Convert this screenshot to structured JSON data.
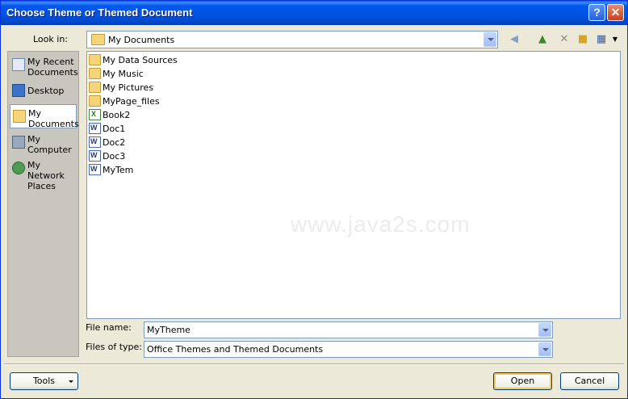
{
  "window": {
    "title": "Choose Theme or Themed Document",
    "help_label": "?",
    "close_label": "✕"
  },
  "lookin": {
    "label": "Look in:",
    "value": "My Documents"
  },
  "places": [
    {
      "label": "My Recent\nDocuments",
      "icon": "recent-documents-icon"
    },
    {
      "label": "Desktop",
      "icon": "desktop-icon"
    },
    {
      "label": "My\nDocuments",
      "icon": "my-documents-icon",
      "selected": true
    },
    {
      "label": "My\nComputer",
      "icon": "computer-icon"
    },
    {
      "label": "My Network\nPlaces",
      "icon": "network-places-icon"
    }
  ],
  "files": [
    {
      "name": "My Data Sources",
      "type": "folder"
    },
    {
      "name": "My Music",
      "type": "folder"
    },
    {
      "name": "My Pictures",
      "type": "folder"
    },
    {
      "name": "MyPage_files",
      "type": "folder"
    },
    {
      "name": "Book2",
      "type": "xls"
    },
    {
      "name": "Doc1",
      "type": "doc"
    },
    {
      "name": "Doc2",
      "type": "doc"
    },
    {
      "name": "Doc3",
      "type": "doc"
    },
    {
      "name": "MyTem",
      "type": "doc"
    }
  ],
  "watermark": "www.java2s.com",
  "filename": {
    "label": "File name:",
    "value": "MyTheme"
  },
  "filetype": {
    "label": "Files of type:",
    "value": "Office Themes and Themed Documents"
  },
  "buttons": {
    "tools": "Tools",
    "open": "Open",
    "cancel": "Cancel"
  },
  "colors": {
    "titlebar": "#0054e3",
    "dialog_bg": "#ece9d8",
    "places_bg": "#c8c6bf",
    "border": "#7f9db9"
  }
}
